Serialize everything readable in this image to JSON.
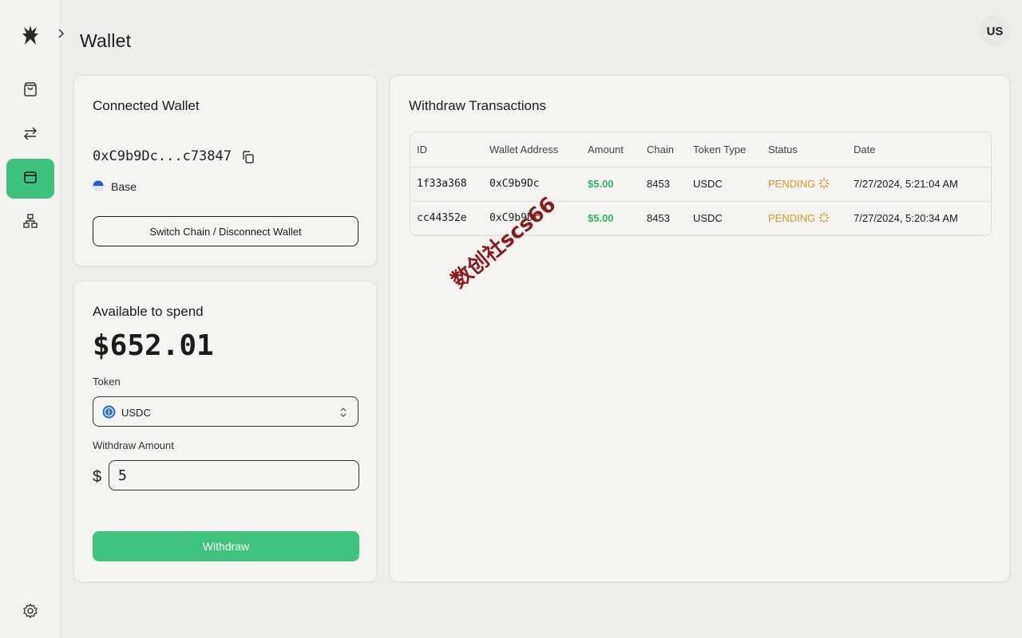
{
  "header": {
    "title": "Wallet",
    "avatar_initials": "US"
  },
  "sidebar": {
    "items": [
      {
        "name": "shopping-bag-icon",
        "active": false
      },
      {
        "name": "transfer-arrows-icon",
        "active": false
      },
      {
        "name": "wallet-icon",
        "active": true
      },
      {
        "name": "sitemap-icon",
        "active": false
      }
    ],
    "accent_color": "#3fc37c"
  },
  "connected_wallet": {
    "title": "Connected Wallet",
    "address": "0xC9b9Dc...c73847",
    "chain": "Base",
    "switch_button": "Switch Chain / Disconnect Wallet"
  },
  "spend": {
    "title": "Available to spend",
    "balance": "$652.01",
    "token_label": "Token",
    "token_value": "USDC",
    "withdraw_label": "Withdraw Amount",
    "currency_symbol": "$",
    "amount_value": "5",
    "withdraw_button": "Withdraw"
  },
  "transactions": {
    "title": "Withdraw Transactions",
    "columns": [
      "ID",
      "Wallet Address",
      "Amount",
      "Chain",
      "Token Type",
      "Status",
      "Date"
    ],
    "rows": [
      {
        "id": "1f33a368",
        "wallet": "0xC9b9Dc",
        "amount": "$5.00",
        "chain": "8453",
        "token": "USDC",
        "status": "PENDING",
        "date": "7/27/2024, 5:21:04 AM"
      },
      {
        "id": "cc44352e",
        "wallet": "0xC9b9Dc",
        "amount": "$5.00",
        "chain": "8453",
        "token": "USDC",
        "status": "PENDING",
        "date": "7/27/2024, 5:20:34 AM"
      }
    ]
  },
  "watermark": "数创社scs66",
  "colors": {
    "success": "#2fb767",
    "pending": "#d39a25",
    "primary_button": "#40c47d"
  }
}
